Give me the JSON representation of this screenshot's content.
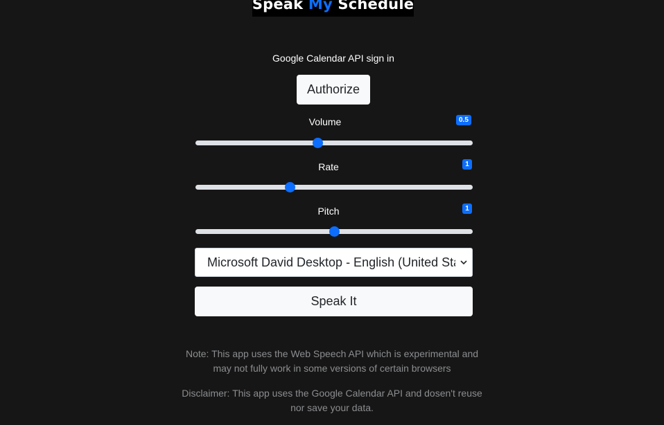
{
  "header": {
    "logo_part1": "Speak ",
    "logo_part2": "My",
    "logo_part3": " Schedule",
    "accent_color": "#0d6efd"
  },
  "auth": {
    "label": "Google Calendar API sign in",
    "button_label": "Authorize"
  },
  "sliders": {
    "volume": {
      "label": "Volume",
      "badge": "0.5",
      "fraction": 0.44
    },
    "rate": {
      "label": "Rate",
      "badge": "1",
      "fraction": 0.34
    },
    "pitch": {
      "label": "Pitch",
      "badge": "1",
      "fraction": 0.5
    }
  },
  "voice": {
    "selected": "Microsoft David Desktop - English (United States)"
  },
  "speak": {
    "button_label": "Speak It"
  },
  "footer": {
    "note": "Note: This app uses the Web Speech API which is experimental and may not fully work in some versions of certain browsers",
    "disclaimer": "Disclaimer: This app uses the Google Calendar API and dosen't reuse nor save your data."
  },
  "colors": {
    "background": "#171616",
    "primary": "#0d6efd",
    "light_button": "#f8f9fa",
    "muted_text": "#8a8d90"
  }
}
